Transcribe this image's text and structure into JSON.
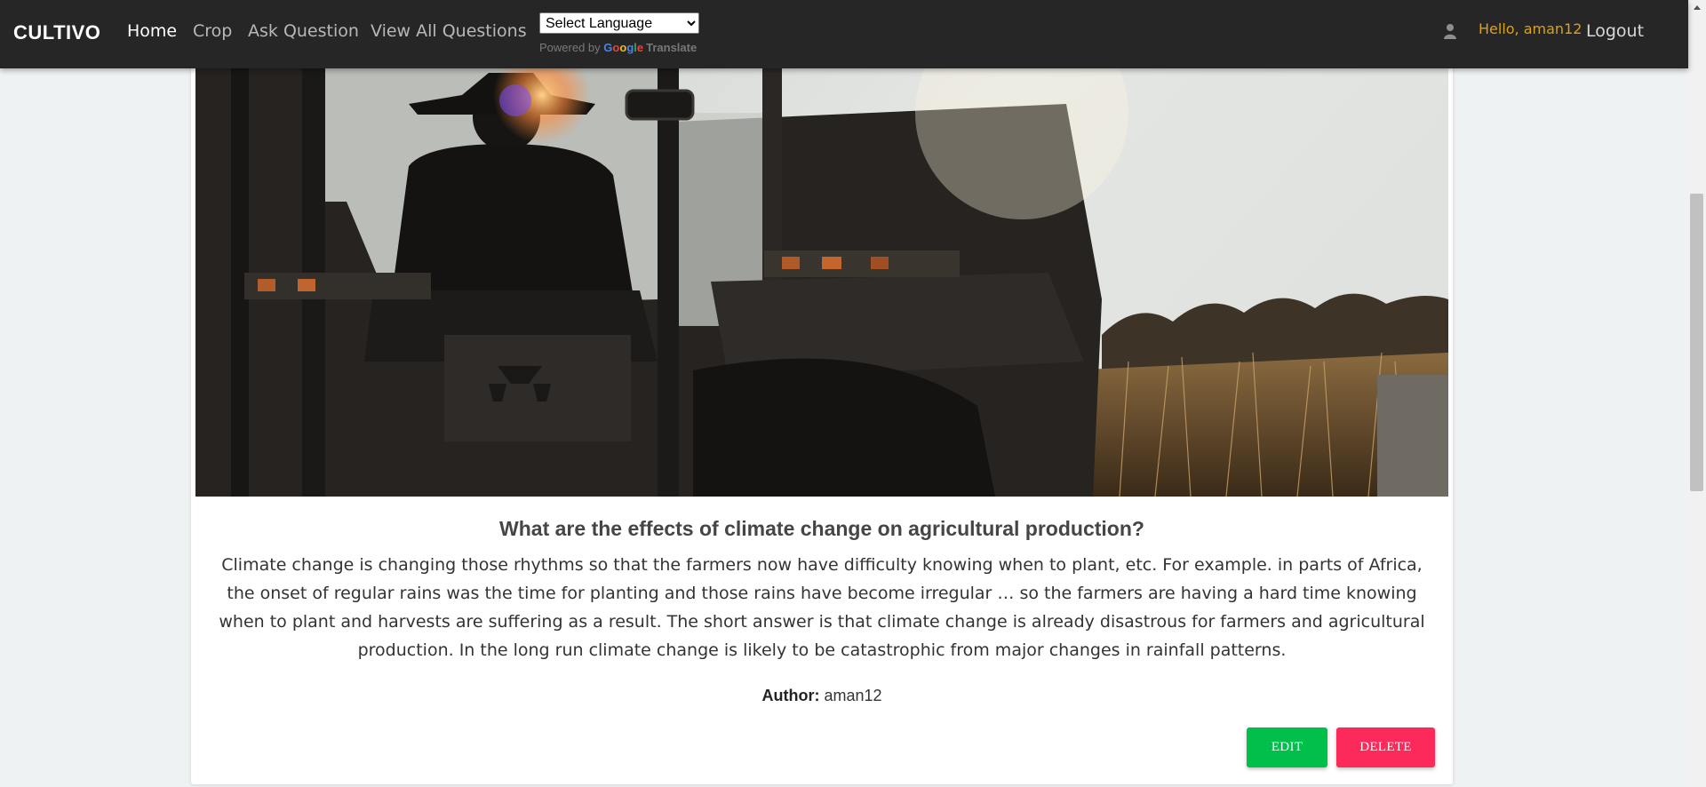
{
  "navbar": {
    "brand": "CULTIVO",
    "links": [
      "Home",
      "Crop",
      "Ask Question",
      "View All Questions"
    ],
    "language_select": {
      "selected": "Select Language"
    },
    "translate_credit": {
      "prefix": "Powered by",
      "google": "Google",
      "suffix": "Translate"
    },
    "user_icon": "user-icon",
    "greeting": "Hello, aman12",
    "logout": "Logout"
  },
  "post": {
    "title": "What are the effects of climate change on agricultural production?",
    "body": "Climate change is changing those rhythms so that the farmers now have difficulty knowing when to plant, etc. For example. in parts of Africa, the onset of regular rains was the time for planting and those rains have become irregular … so the farmers are having a hard time knowing when to plant and harvests are suffering as a result. The short answer is that climate change is already disastrous for farmers and agricultural production. In the long run climate change is likely to be catastrophic from major changes in rainfall patterns.",
    "author_label": "Author:",
    "author": "aman12",
    "edit_label": "EDIT",
    "delete_label": "DELETE"
  },
  "colors": {
    "navbar_bg": "#262626",
    "greeting": "#d9a21a",
    "edit": "#00c04b",
    "delete": "#fb2a5a"
  }
}
